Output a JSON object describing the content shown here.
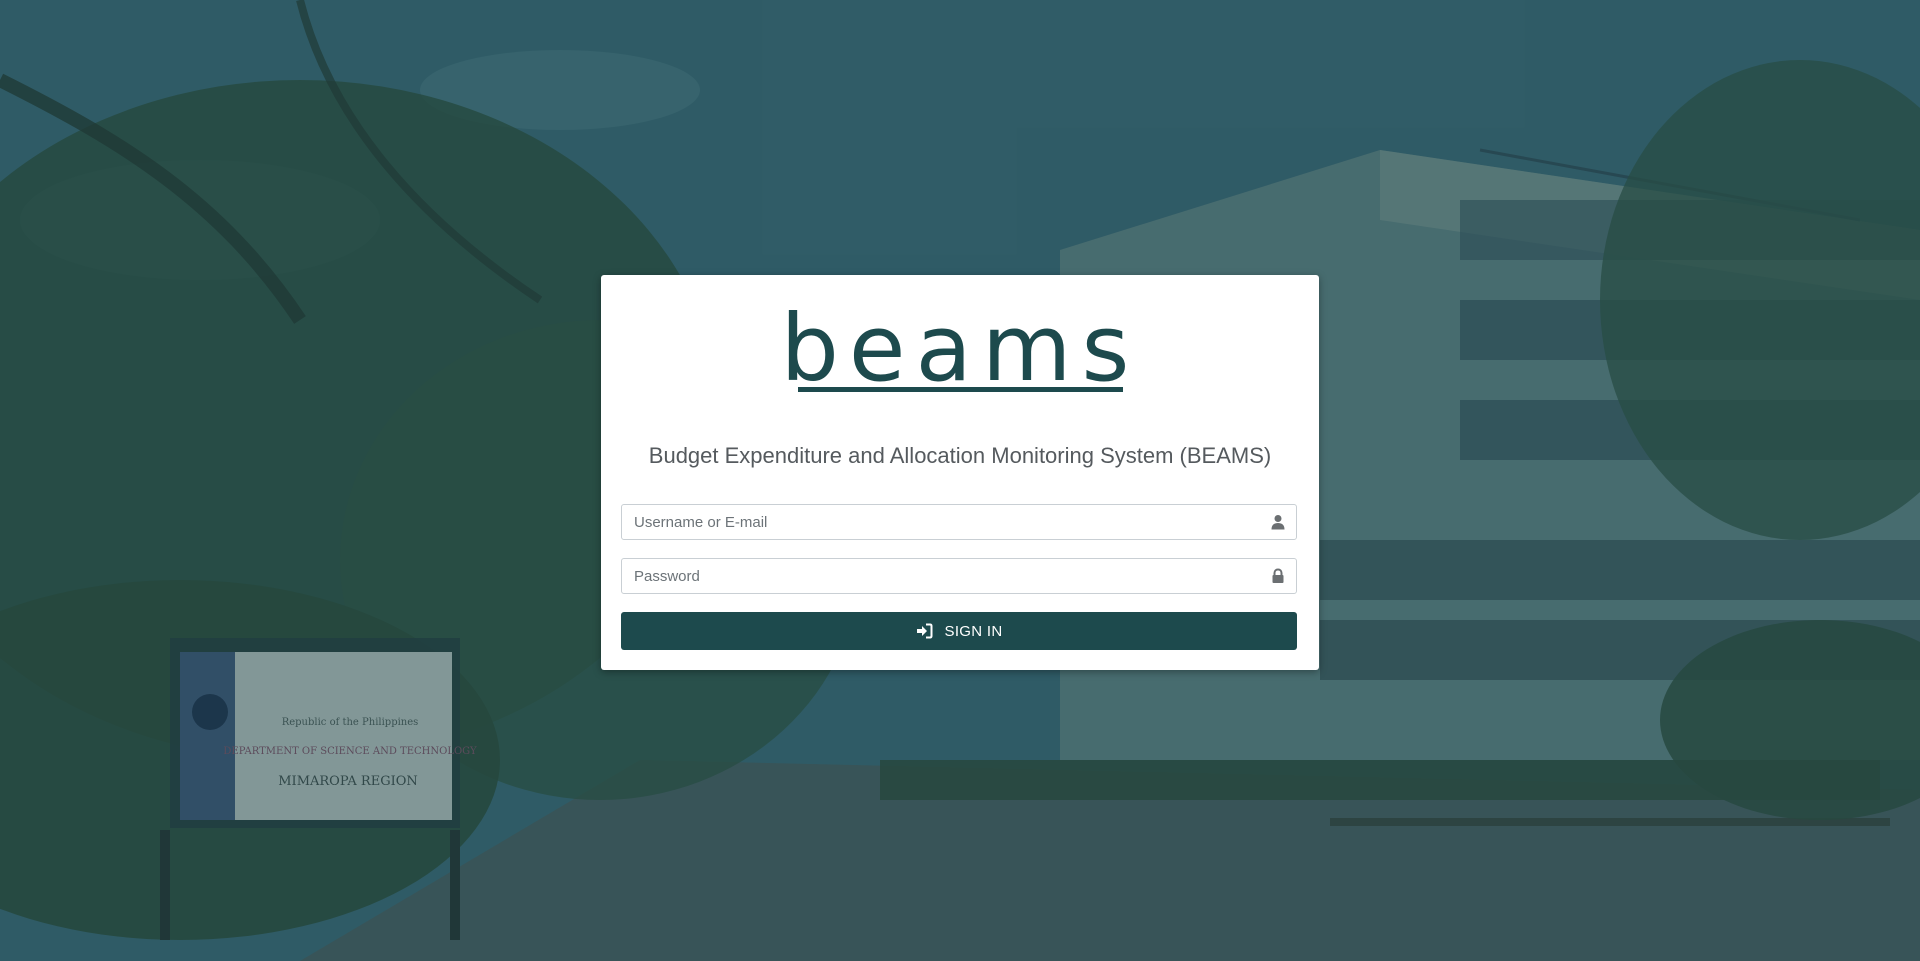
{
  "login": {
    "logo_text": "beams",
    "subtitle": "Budget Expenditure and Allocation Monitoring System (BEAMS)",
    "username": {
      "placeholder": "Username or E-mail",
      "value": "",
      "icon": "user-icon"
    },
    "password": {
      "placeholder": "Password",
      "value": "",
      "icon": "lock-icon"
    },
    "signin_button": {
      "label": "SIGN IN",
      "icon": "sign-in-icon"
    }
  },
  "background": {
    "sign_lines": [
      "Republic of the Philippines",
      "DEPARTMENT OF SCIENCE AND TECHNOLOGY",
      "MIMAROPA REGION"
    ]
  },
  "colors": {
    "brand": "#1d4a4d",
    "overlay": "#1c464e",
    "card": "#ffffff",
    "subtitle": "#555a5e"
  }
}
